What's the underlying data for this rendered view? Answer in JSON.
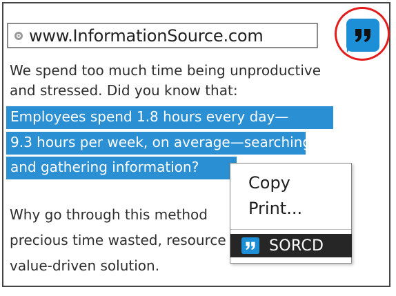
{
  "browser": {
    "url": "www.InformationSource.com",
    "globe_icon": "globe-icon",
    "extension_icon": "quote-icon",
    "extension_color": "#1c8fd6",
    "highlight_circle_color": "#e21b1b"
  },
  "content": {
    "intro_lines": [
      "We spend too much time being unproductive",
      "and stressed.  Did you know that:"
    ],
    "highlighted_lines": [
      "Employees  spend 1.8 hours every day—",
      "9.3 hours per week, on average—searching",
      "and gathering information?"
    ],
    "highlight_color": "#2a8fd3",
    "closing_lines": [
      "Why go through this method",
      "precious time wasted, resource",
      "value-driven solution."
    ]
  },
  "context_menu": {
    "copy_label": "Copy",
    "print_label": "Print...",
    "sorcd_label": "SORCD",
    "sorcd_icon": "quote-icon"
  }
}
